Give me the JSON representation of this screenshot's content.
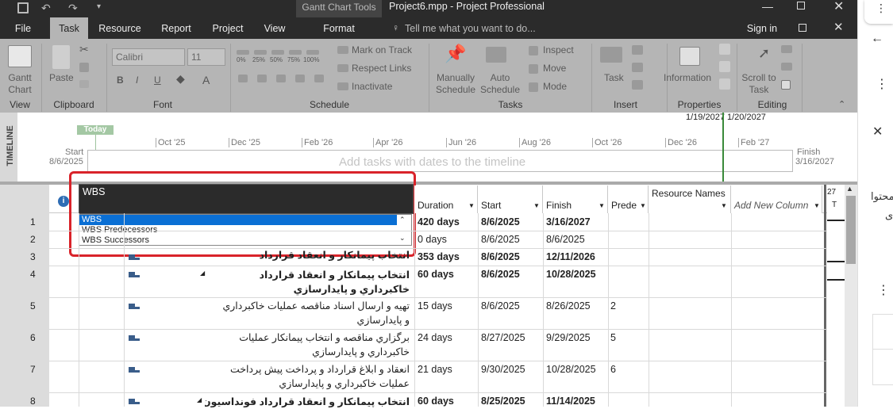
{
  "titlebar": {
    "context": "Gantt Chart Tools",
    "title": "Project6.mpp - Project Professional"
  },
  "tabs": [
    "File",
    "Task",
    "Resource",
    "Report",
    "Project",
    "View",
    "Format"
  ],
  "tell_me": "Tell me what you want to do...",
  "sign_in": "Sign in",
  "ribbon": {
    "gantt_chart": "Gantt Chart",
    "paste": "Paste",
    "font_name": "Calibri",
    "font_size": "11",
    "bold": "B",
    "italic": "I",
    "underline": "U",
    "pct": [
      "0%",
      "25%",
      "50%",
      "75%",
      "100%"
    ],
    "mark_on_track": "Mark on Track",
    "respect_links": "Respect Links",
    "inactivate": "Inactivate",
    "manually": "Manually Schedule",
    "auto": "Auto Schedule",
    "inspect": "Inspect",
    "move": "Move",
    "mode": "Mode",
    "task": "Task",
    "information": "Information",
    "scroll": "Scroll to Task",
    "groups": [
      "View",
      "Clipboard",
      "Font",
      "Schedule",
      "Tasks",
      "Insert",
      "Properties",
      "Editing"
    ]
  },
  "timeline": {
    "label": "TIMELINE",
    "today": "Today",
    "start_label": "Start",
    "start_date": "8/6/2025",
    "finish_label": "Finish",
    "finish_date": "3/16/2027",
    "placeholder": "Add tasks with dates to the timeline",
    "marker_dates": "1/19/2027 1/20/2027",
    "months": [
      "Oct '25",
      "Dec '25",
      "Feb '26",
      "Apr '26",
      "Jun '26",
      "Aug '26",
      "Oct '26",
      "Dec '26",
      "Feb '27"
    ]
  },
  "columns": {
    "info": "i",
    "duration": "Duration",
    "start": "Start",
    "finish": "Finish",
    "predecessors": "Prede",
    "resource": "Resource Names",
    "add_new": "Add New Column",
    "gantt_num": "27",
    "gantt_t": "T"
  },
  "field_editor": {
    "value": "WBS",
    "options": [
      "WBS",
      "WBS Predecessors",
      "WBS Successors"
    ]
  },
  "rows": [
    {
      "id": "1",
      "name": "",
      "duration": "420 days",
      "start": "8/6/2025",
      "finish": "3/16/2027",
      "pred": "",
      "bold": true
    },
    {
      "id": "2",
      "name": "",
      "duration": "0 days",
      "start": "8/6/2025",
      "finish": "8/6/2025",
      "pred": "",
      "bold": false
    },
    {
      "id": "3",
      "name": "انتخاب پیمانکار و انعقاد قرارداد",
      "duration": "353 days",
      "start": "8/6/2025",
      "finish": "12/11/2026",
      "pred": "",
      "bold": true
    },
    {
      "id": "4",
      "name": "انتخاب پيمانكار و انعقاد قرارداد خاكبرداري و پايدارسازي",
      "duration": "60 days",
      "start": "8/6/2025",
      "finish": "10/28/2025",
      "pred": "",
      "bold": true
    },
    {
      "id": "5",
      "name": "تهيه و ارسال اسناد مناقصه عمليات خاكبرداري و پايدارسازي",
      "duration": "15 days",
      "start": "8/6/2025",
      "finish": "8/26/2025",
      "pred": "2",
      "bold": false
    },
    {
      "id": "6",
      "name": "برگزاري مناقصه و انتخاب پيمانكار عمليات خاكبرداري و پايدارسازي",
      "duration": "24 days",
      "start": "8/27/2025",
      "finish": "9/29/2025",
      "pred": "5",
      "bold": false
    },
    {
      "id": "7",
      "name": "انعقاد و ابلاغ قرارداد و پرداخت پيش پرداخت عمليات خاكبرداري و پايدارسازي",
      "duration": "21 days",
      "start": "9/30/2025",
      "finish": "10/28/2025",
      "pred": "6",
      "bold": false
    },
    {
      "id": "8",
      "name": "انتخاب پيمانكار و انعقاد قرارداد فونداسيون، ديوار",
      "duration": "60 days",
      "start": "8/25/2025",
      "finish": "11/14/2025",
      "pred": "",
      "bold": true
    }
  ],
  "side": {
    "partial1": "محتوا",
    "partial2": "ی"
  }
}
